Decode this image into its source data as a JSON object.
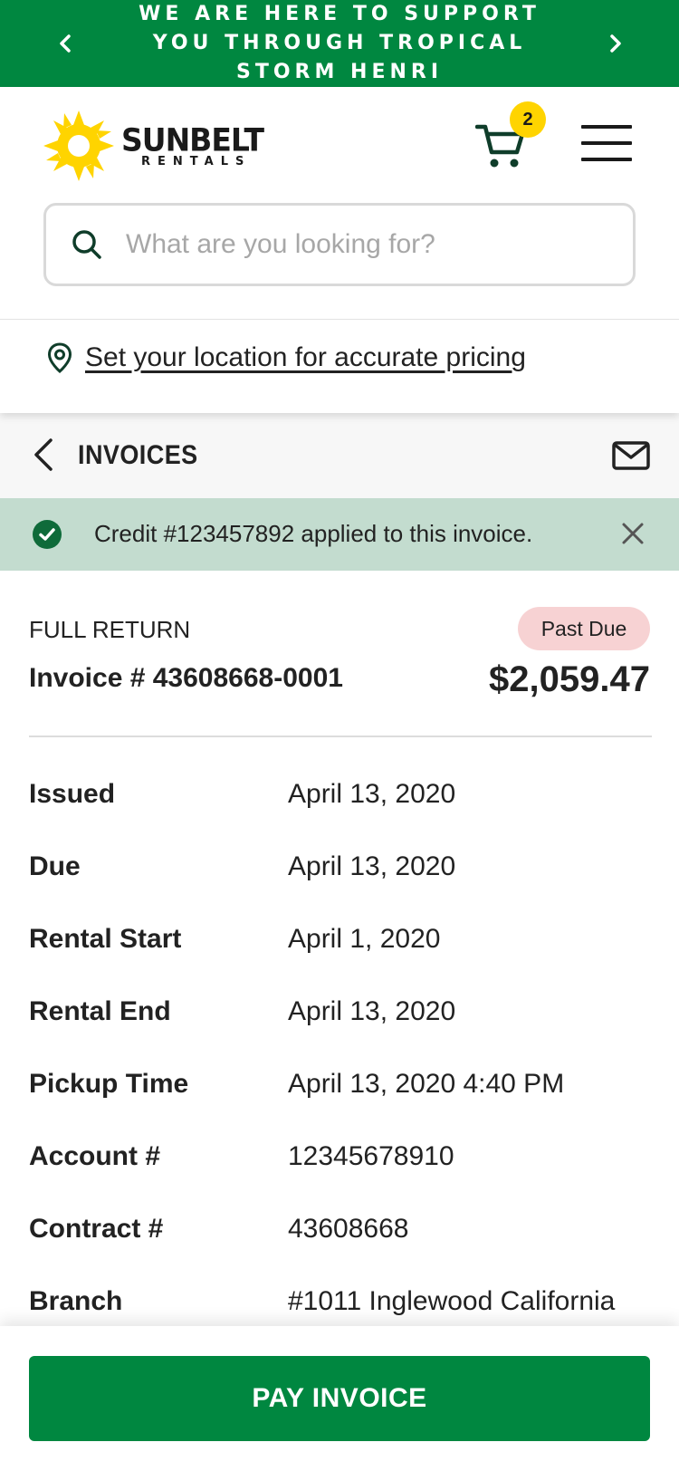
{
  "banner": {
    "text": "WE ARE HERE TO SUPPORT YOU THROUGH TROPICAL STORM HENRI",
    "color": "#008740"
  },
  "header": {
    "logo_main": "SUNBELT",
    "logo_sub": "RENTALS",
    "cart_count": "2",
    "search_placeholder": "What are you looking for?",
    "location_link": "Set your location for accurate pricing"
  },
  "subheader": {
    "title": "INVOICES"
  },
  "notice": {
    "text": "Credit #123457892 applied to this invoice.",
    "color": "#c3dccf"
  },
  "invoice": {
    "return_type": "FULL RETURN",
    "status": "Past Due",
    "number": "Invoice # 43608668-0001",
    "amount": "$2,059.47",
    "details": [
      {
        "label": "Issued",
        "value": "April 13, 2020"
      },
      {
        "label": "Due",
        "value": "April 13, 2020"
      },
      {
        "label": "Rental Start",
        "value": "April 1, 2020"
      },
      {
        "label": "Rental End",
        "value": "April 13, 2020"
      },
      {
        "label": "Pickup Time",
        "value": "April 13, 2020 4:40 PM"
      },
      {
        "label": "Account #",
        "value": "12345678910"
      },
      {
        "label": "Contract #",
        "value": "43608668"
      },
      {
        "label": "Branch",
        "value": "#1011 Inglewood California"
      }
    ]
  },
  "actions": {
    "pay_label": "PAY INVOICE",
    "brand_green": "#008740",
    "brand_yellow": "#ffd400"
  },
  "icons": [
    "chevron-left-icon",
    "chevron-right-icon",
    "cart-icon",
    "menu-icon",
    "search-icon",
    "location-pin-icon",
    "back-arrow-icon",
    "mail-icon",
    "check-circle-icon",
    "close-icon"
  ]
}
